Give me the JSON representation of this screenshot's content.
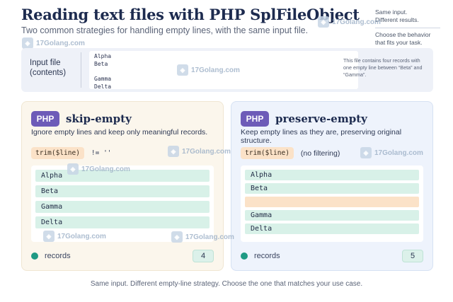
{
  "header": {
    "title": "Reading text files with PHP SplFileObject",
    "subtitle": "Two common strategies for handling empty lines, with the same input file."
  },
  "side_note": {
    "line1": "Same input.",
    "line2": "Different results.",
    "line3": "Choose the behavior",
    "line4": "that fits your task."
  },
  "watermark": {
    "text": "17Golang.com",
    "icon": "logo-mark-icon"
  },
  "input": {
    "label_line1": "Input file",
    "label_line2": "(contents)",
    "lines": [
      "Alpha",
      "Beta",
      "",
      "Gamma",
      "Delta"
    ],
    "description": "This file contains four records with one empty line between “Beta” and “Gamma”."
  },
  "skip_empty": {
    "badge": "PHP",
    "title": "skip-empty",
    "description": "Ignore empty lines and keep only meaningful records.",
    "code": "trim($line)",
    "code_after": "!= ''",
    "results": [
      "Alpha",
      "Beta",
      "Gamma",
      "Delta"
    ],
    "records_label": "records",
    "count": "4"
  },
  "preserve_empty": {
    "badge": "PHP",
    "title": "preserve-empty",
    "description": "Keep empty lines as they are, preserving original structure.",
    "code": "trim($line)",
    "code_after": "(no filtering)",
    "results": [
      "Alpha",
      "Beta",
      "",
      "Gamma",
      "Delta"
    ],
    "records_label": "records",
    "count": "5"
  },
  "caption": "Same input. Different empty-line strategy. Choose the one that matches your use case.",
  "colors": {
    "badge": "#6d5bb8",
    "record_fill": "#d8f1e8",
    "empty_fill": "#fbe2c8",
    "status_dot": "#1f9a84"
  }
}
